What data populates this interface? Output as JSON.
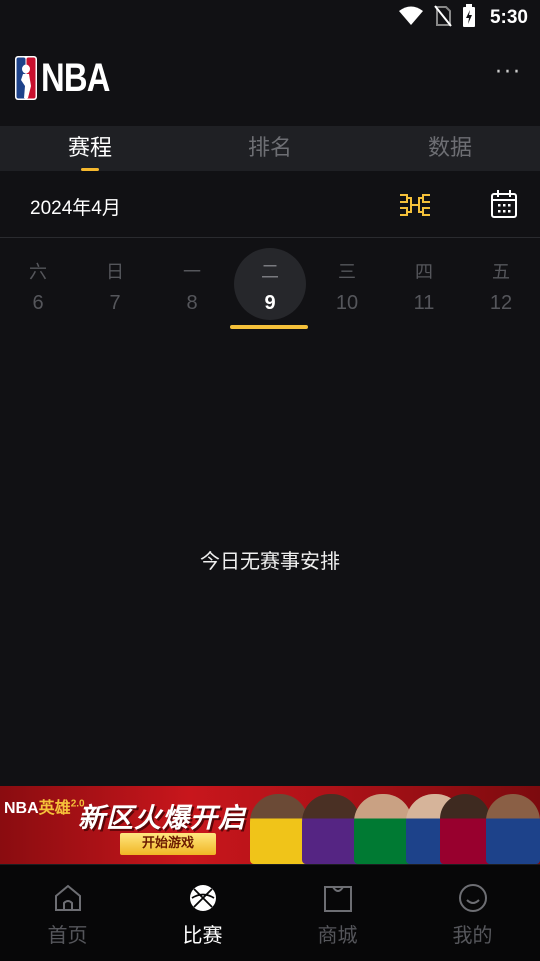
{
  "status_bar": {
    "time": "5:30",
    "icons": [
      "wifi-icon",
      "no-sim-icon",
      "battery-charging-icon"
    ]
  },
  "header": {
    "logo_text": "NBA",
    "more_label": "···"
  },
  "tabs": [
    {
      "label": "赛程",
      "active": true
    },
    {
      "label": "排名",
      "active": false
    },
    {
      "label": "数据",
      "active": false
    }
  ],
  "date_bar": {
    "month": "2024年4月",
    "icons": [
      "bracket-icon",
      "calendar-icon"
    ]
  },
  "week": [
    {
      "weekday": "六",
      "date": "6",
      "selected": false
    },
    {
      "weekday": "日",
      "date": "7",
      "selected": false
    },
    {
      "weekday": "一",
      "date": "8",
      "selected": false
    },
    {
      "weekday": "二",
      "date": "9",
      "selected": true
    },
    {
      "weekday": "三",
      "date": "10",
      "selected": false
    },
    {
      "weekday": "四",
      "date": "11",
      "selected": false
    },
    {
      "weekday": "五",
      "date": "12",
      "selected": false
    }
  ],
  "empty_message": "今日无赛事安排",
  "banner": {
    "brand": "NBA",
    "brand_hero": "英雄",
    "brand_version": "2.0",
    "headline": "新区火爆开启",
    "cta": "开始游戏"
  },
  "bottom_nav": [
    {
      "label": "首页",
      "icon": "home-icon",
      "active": false
    },
    {
      "label": "比赛",
      "icon": "basketball-icon",
      "active": true
    },
    {
      "label": "商城",
      "icon": "shopping-bag-icon",
      "active": false
    },
    {
      "label": "我的",
      "icon": "profile-icon",
      "active": false
    }
  ],
  "colors": {
    "accent": "#f5c13a",
    "background": "#111114",
    "tab_bar": "#1f2024",
    "inactive_text": "#55565b"
  }
}
